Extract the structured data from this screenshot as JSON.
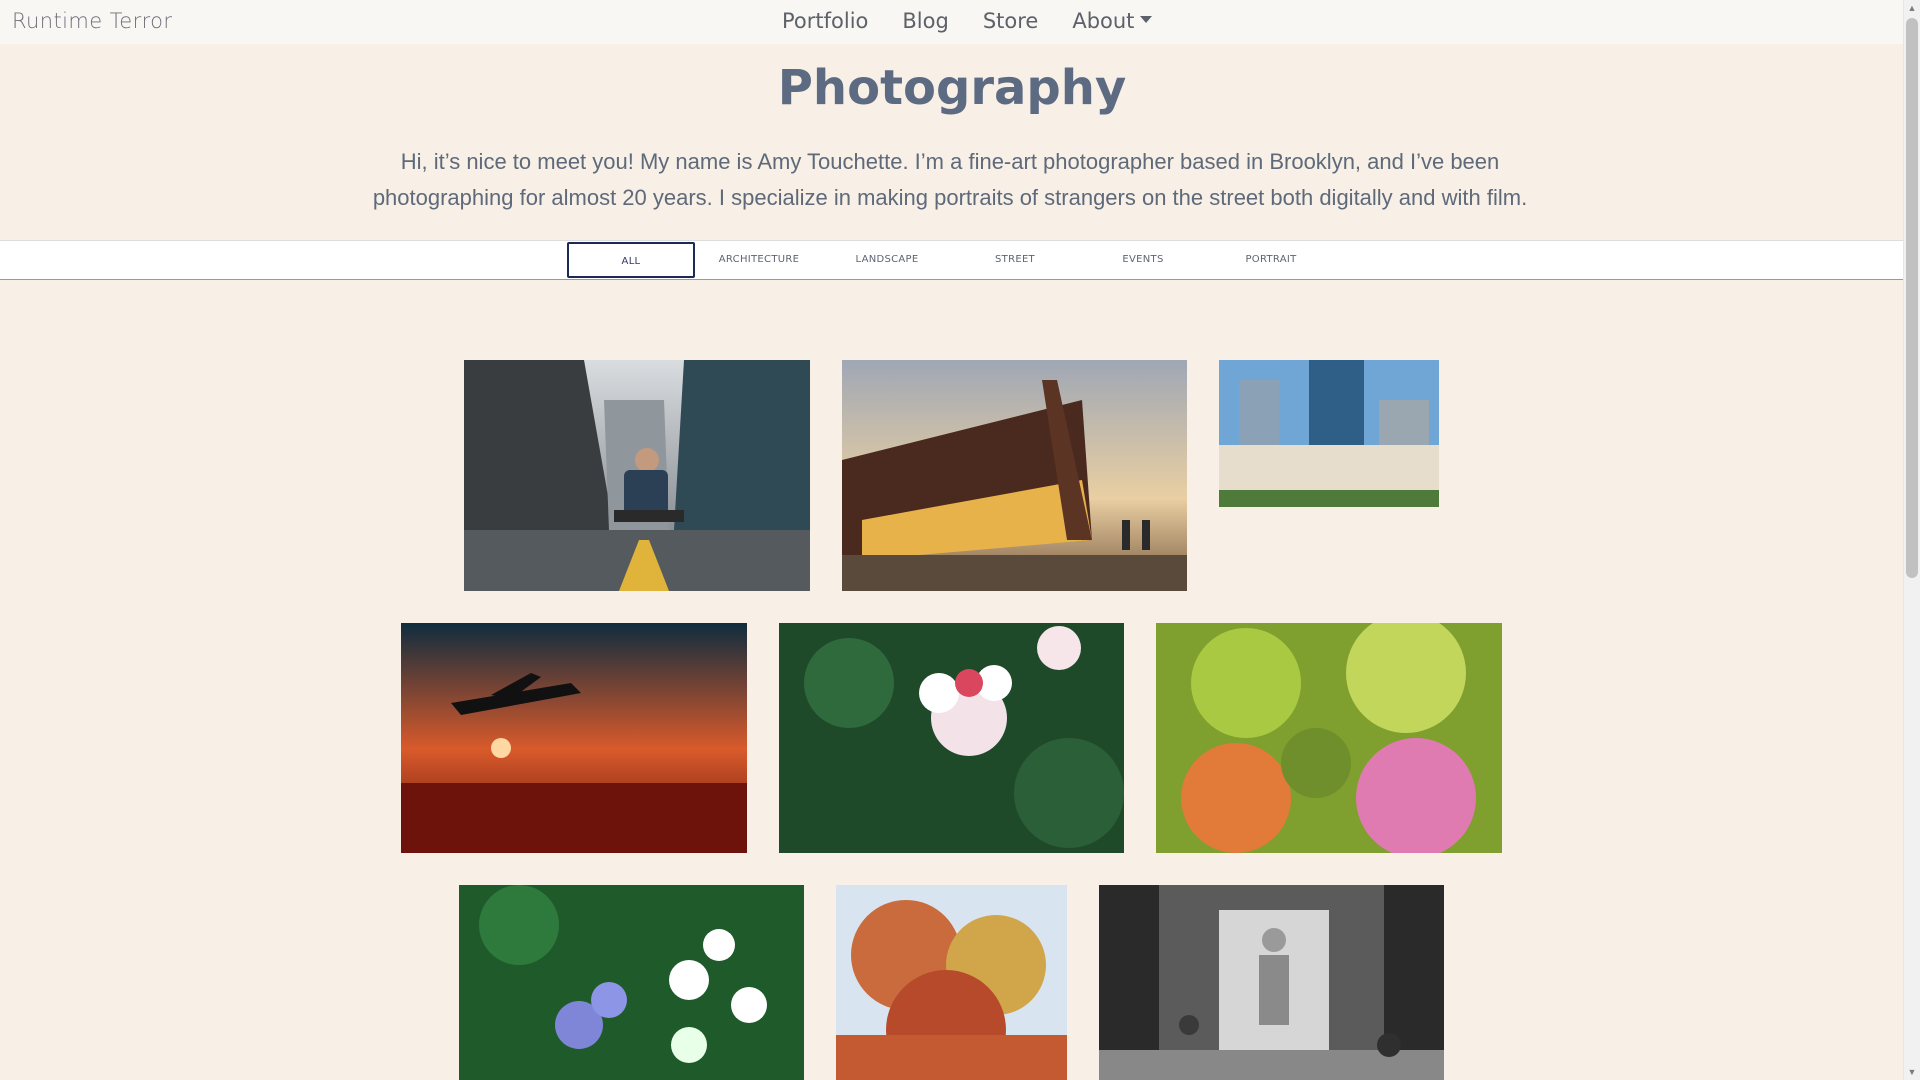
{
  "brand": "Runtime Terror",
  "nav": {
    "items": [
      {
        "label": "Portfolio"
      },
      {
        "label": "Blog"
      },
      {
        "label": "Store"
      },
      {
        "label": "About",
        "has_dropdown": true
      }
    ]
  },
  "hero": {
    "title": "Photography",
    "intro": "Hi, it’s nice to meet you! My name is Amy Touchette. I’m a fine-art photographer based in Brooklyn, and I’ve been photographing for almost 20 years. I specialize in making portraits of strangers on the street both digitally and with film."
  },
  "filters": {
    "active": "ALL",
    "items": [
      "ALL",
      "ARCHITECTURE",
      "LANDSCAPE",
      "STREET",
      "EVENTS",
      "PORTRAIT"
    ]
  },
  "gallery": {
    "photos": [
      {
        "subject": "photographer crouching in city street",
        "icon": "image-icon"
      },
      {
        "subject": "angular modern building at sunset",
        "icon": "image-icon"
      },
      {
        "subject": "city skyscrapers and hotel",
        "icon": "image-icon"
      },
      {
        "subject": "airplane silhouette over red sunset sea",
        "icon": "image-icon"
      },
      {
        "subject": "pink and white fuchsia flowers",
        "icon": "image-icon"
      },
      {
        "subject": "orange and pink flowers with green leaves",
        "icon": "image-icon"
      },
      {
        "subject": "white daisies and blue flowers",
        "icon": "image-icon"
      },
      {
        "subject": "autumn tree against sky",
        "icon": "image-icon"
      },
      {
        "subject": "black and white street with people walking",
        "icon": "image-icon"
      }
    ]
  },
  "colors": {
    "page_bg": "#f8efe6",
    "title": "#5c6a82",
    "active_filter_border": "#1b2a57"
  }
}
